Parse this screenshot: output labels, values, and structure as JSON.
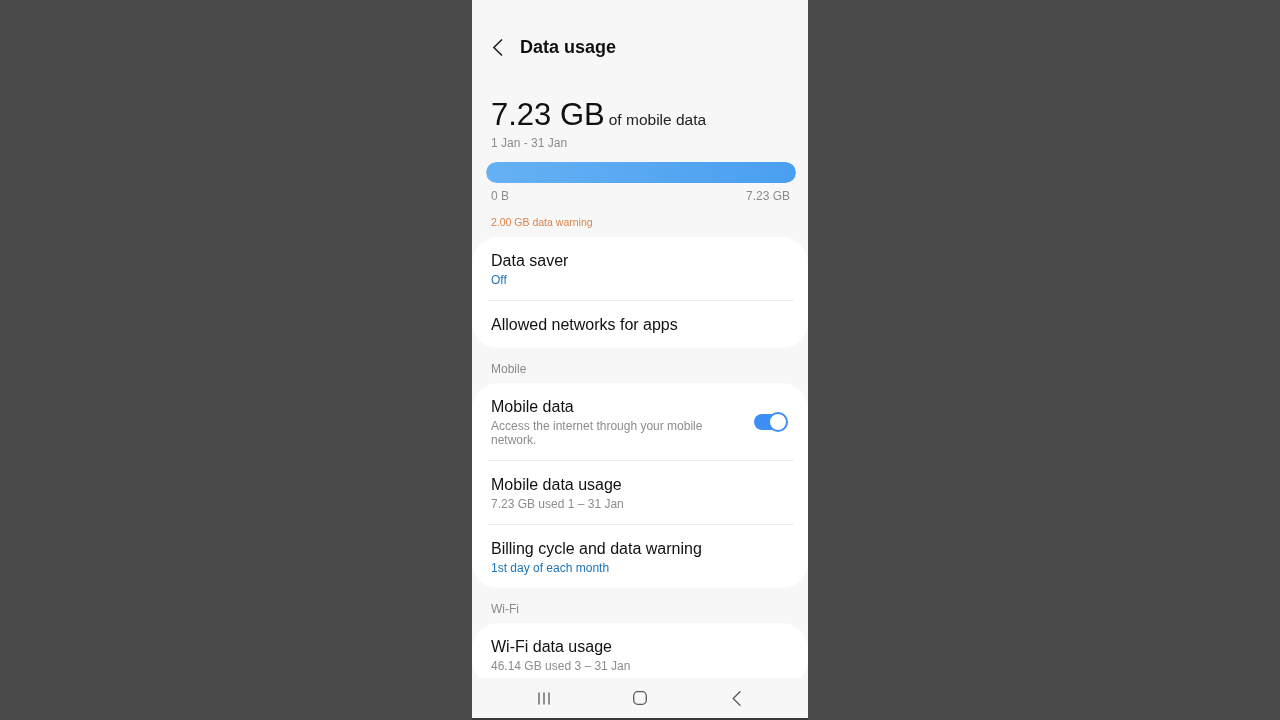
{
  "header": {
    "title": "Data usage"
  },
  "summary": {
    "amount": "7.23 GB",
    "amount_caption": "of mobile data",
    "period": "1 Jan - 31 Jan",
    "usage_bar": {
      "level": 1,
      "start_label": "0 B",
      "end_label": "7.23 GB"
    },
    "warning": "2.00 GB data warning"
  },
  "sections": [
    {
      "items": [
        {
          "kind": "link",
          "title": "Data saver",
          "subtitle": "Off",
          "subtitle_highlighted": true
        },
        {
          "kind": "link",
          "title": "Allowed networks for apps"
        }
      ]
    },
    {
      "header": "Mobile",
      "items": [
        {
          "kind": "switch",
          "title": "Mobile data",
          "subtitle": "Access the internet through your mobile network.",
          "subtitle_highlighted": false,
          "on": true
        },
        {
          "kind": "link",
          "title": "Mobile data usage",
          "subtitle": "7.23 GB used 1 – 31 Jan",
          "subtitle_highlighted": false
        },
        {
          "kind": "link",
          "title": "Billing cycle and data warning",
          "subtitle": "1st day of each month",
          "subtitle_highlighted": true
        }
      ]
    },
    {
      "header": "Wi-Fi",
      "items": [
        {
          "kind": "link",
          "title": "Wi-Fi data usage",
          "subtitle": "46.14 GB used 3 – 31 Jan",
          "subtitle_highlighted": false
        }
      ]
    }
  ]
}
